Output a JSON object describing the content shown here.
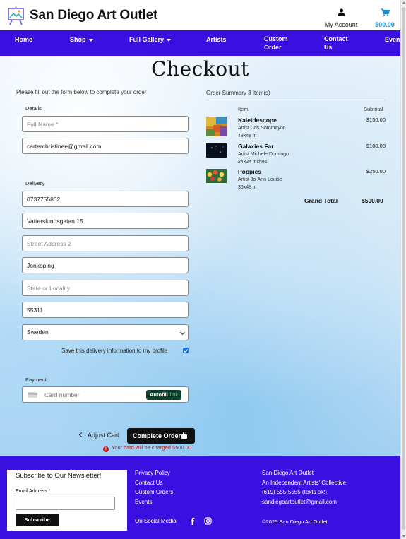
{
  "header": {
    "brand": "San Diego Art Outlet",
    "account_label": "My Account",
    "cart_amount": "500.00",
    "accent_color": "#3a10e0",
    "cart_color": "#1b8fc9"
  },
  "nav": {
    "home": "Home",
    "shop": "Shop",
    "full_gallery": "Full Gallery",
    "artists": "Artists",
    "custom_order": "Custom Order",
    "contact_us": "Contact Us",
    "events": "Events"
  },
  "page": {
    "title": "Checkout",
    "intro": "Please fill out the form below to complete your order"
  },
  "form": {
    "details_label": "Details",
    "full_name_placeholder": "Full Name *",
    "email_value": "carterchristinee@gmail.com",
    "delivery_label": "Delivery",
    "phone_value": "0737755802",
    "street1_value": "Vatterslundsgatan 15",
    "street2_placeholder": "Street Address 2",
    "city_value": "Jonkoping",
    "state_placeholder": "State or Locality",
    "postcode_value": "55311",
    "country_value": "Sweden",
    "save_label": "Save this delivery information to my profile",
    "payment_label": "Payment",
    "card_placeholder": "Card number",
    "autofill_label": "Autofill",
    "autofill_link": "link"
  },
  "actions": {
    "adjust_cart": "Adjust Cart",
    "complete_order": "Complete Order",
    "charge_note": "Your card will be charged $500.00"
  },
  "summary": {
    "title": "Order Summary 3 Item(s)",
    "col_item": "Item",
    "col_subtotal": "Subtotal",
    "items": [
      {
        "name": "Kaleidescope",
        "artist": "Artist Cris Sotomayor",
        "size": "48x48 in",
        "price": "$150.00"
      },
      {
        "name": "Galaxies Far",
        "artist": "Artist Michele Domingo",
        "size": "24x24 inches",
        "price": "$100.00"
      },
      {
        "name": "Poppies",
        "artist": "Artist Jo-Ann Louise",
        "size": "36x48 in",
        "price": "$250.00"
      }
    ],
    "grand_total_label": "Grand Total",
    "grand_total_value": "$500.00"
  },
  "footer": {
    "newsletter_title": "Subscribe to Our Newsletter!",
    "email_label": "Email Address",
    "required_mark": "*",
    "subscribe_button": "Subscribe",
    "links": [
      "Privacy Policy",
      "Contact Us",
      "Custom Orders",
      "Events"
    ],
    "social_label": "On Social Media",
    "info": [
      "San Diego Art Outlet",
      "An Independent Artists' Collective",
      "(619) 555-5555 (texts ok!)",
      "sandiegoartoutlet@gmail.com"
    ],
    "copyright": "©2025 San Diego Art Outlet"
  }
}
